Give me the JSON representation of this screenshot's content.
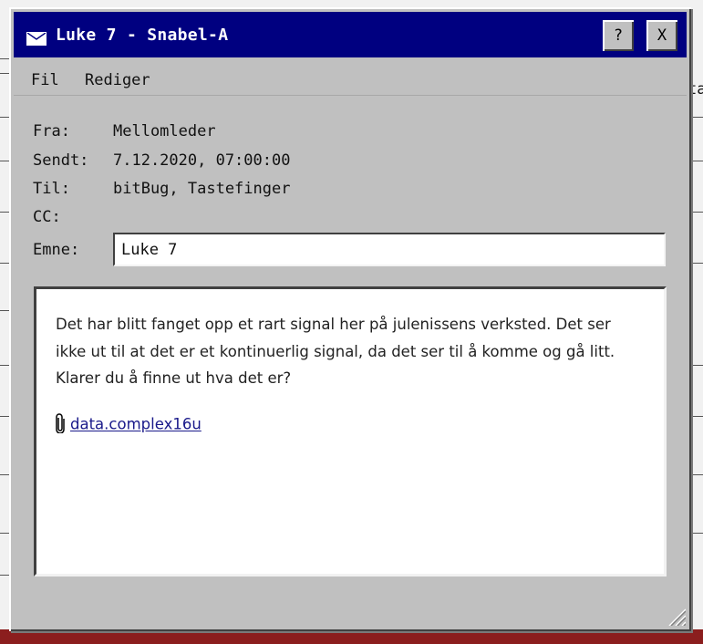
{
  "window": {
    "title": "Luke 7 - Snabel-A",
    "help_label": "?",
    "close_label": "X",
    "icon": "envelope-icon"
  },
  "menu": {
    "items": [
      {
        "label": "Fil"
      },
      {
        "label": "Rediger"
      }
    ]
  },
  "headers": {
    "from_label": "Fra:",
    "from_value": "Mellomleder",
    "sent_label": "Sendt:",
    "sent_value": "7.12.2020, 07:00:00",
    "to_label": "Til:",
    "to_value": "bitBug, Tastefinger",
    "cc_label": "CC:",
    "cc_value": "",
    "subject_label": "Emne:",
    "subject_value": "Luke 7"
  },
  "message": {
    "line1": "Det har blitt fanget opp et rart signal her på julenissens verksted. Det ser",
    "line2": "ikke ut til at det er et kontinuerlig signal, da det ser til å komme og gå litt.",
    "line3": "Klarer du å finne ut hva det er?",
    "attachment": "data.complex16u",
    "attachment_icon": "paperclip-icon"
  },
  "background": {
    "right_edge_text": "ta"
  },
  "colors": {
    "titlebar": "#000080",
    "window": "#c0c0c0",
    "taskbar": "#8b1e1e"
  }
}
